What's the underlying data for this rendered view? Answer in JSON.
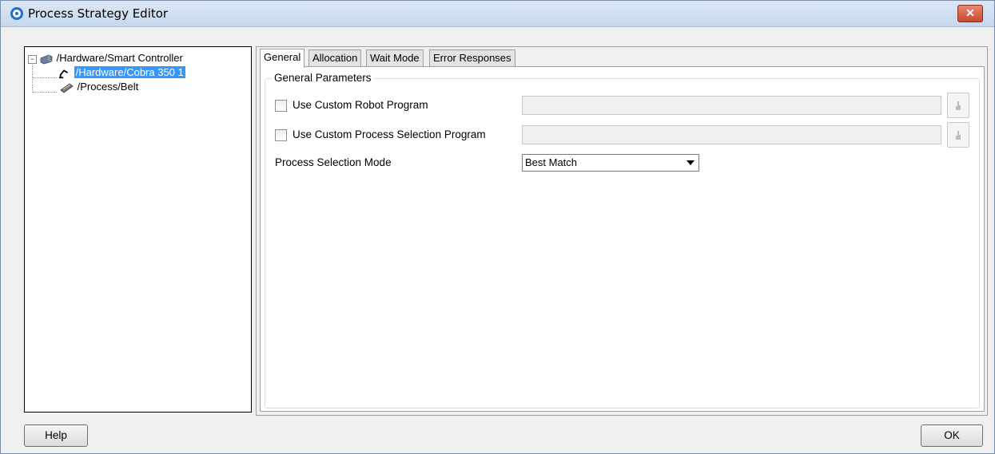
{
  "window": {
    "title": "Process Strategy Editor",
    "close_label": "✕"
  },
  "tree": {
    "toggle": "−",
    "items": [
      {
        "label": "/Hardware/Smart Controller"
      },
      {
        "label": "/Hardware/Cobra 350 1"
      },
      {
        "label": "/Process/Belt"
      }
    ]
  },
  "tabs": [
    {
      "label": "General"
    },
    {
      "label": "Allocation"
    },
    {
      "label": "Wait Mode"
    },
    {
      "label": "Error Responses"
    }
  ],
  "general": {
    "group_title": "General Parameters",
    "custom_robot_program": {
      "label": "Use Custom Robot Program",
      "checked": false,
      "value": ""
    },
    "custom_process_selection": {
      "label": "Use Custom Process Selection Program",
      "checked": false,
      "value": ""
    },
    "process_selection_mode": {
      "label": "Process Selection Mode",
      "selected": "Best Match"
    }
  },
  "footer": {
    "help_label": "Help",
    "ok_label": "OK"
  },
  "colors": {
    "selection": "#3399ff",
    "close": "#c9492e",
    "titlebar": "#c7d8ee"
  }
}
